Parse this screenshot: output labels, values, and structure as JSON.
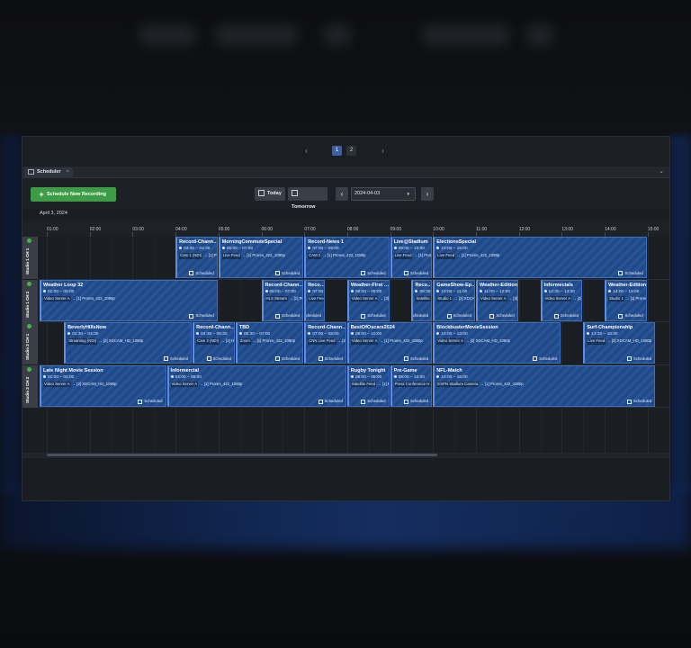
{
  "pager": {
    "prev": "‹",
    "next": "›",
    "pages": [
      "1",
      "2"
    ],
    "active_page": "1"
  },
  "tab": {
    "label": "Scheduler",
    "close": "×"
  },
  "toolbar": {
    "schedule_label": "Schedule New Recording",
    "today_label": "Today",
    "tomorrow_label": "Tomorrow",
    "date_value": "2024-04-03",
    "prev_arrow": "‹",
    "next_arrow": "›"
  },
  "date_label": "April 3, 2024",
  "timeline": {
    "hours": [
      "01:00",
      "02:00",
      "03:00",
      "04:00",
      "05:00",
      "06:00",
      "07:00",
      "08:00",
      "09:00",
      "10:00",
      "11:00",
      "12:00",
      "13:00",
      "14:00",
      "15:00"
    ]
  },
  "rows": [
    {
      "label": "Studio 1 CH 1",
      "status": "online"
    },
    {
      "label": "Studio 1 CH 2",
      "status": "online"
    },
    {
      "label": "Studio 2 CH 1",
      "status": "online"
    },
    {
      "label": "Studio 2 CH 2",
      "status": "online"
    }
  ],
  "events": [
    {
      "row": 0,
      "start": 4.0,
      "end": 5.0,
      "title": "Record-Chann…",
      "time": "03:30 – 04:30",
      "in": "Cam 1 (NDI)",
      "out": "[1] Prores_422_1080p",
      "status": "Scheduled"
    },
    {
      "row": 0,
      "start": 5.0,
      "end": 7.0,
      "title": "MorningCommuteSpecial",
      "time": "05:00 – 07:00",
      "in": "Live Feed",
      "out": "[1] Prores_422_1080p",
      "status": "Scheduled"
    },
    {
      "row": 0,
      "start": 7.0,
      "end": 9.0,
      "title": "Record-News 1",
      "time": "07:00 – 09:00",
      "in": "CAM 2",
      "out": "[1] Prores_422_1080p",
      "status": "Scheduled"
    },
    {
      "row": 0,
      "start": 9.0,
      "end": 10.0,
      "title": "Live@Stadium",
      "time": "09:00 – 10:00",
      "in": "Live Feed",
      "out": "[1] Prores_422_1080p",
      "status": "Scheduled"
    },
    {
      "row": 0,
      "start": 10.0,
      "end": 15.0,
      "title": "ElectionsSpecial",
      "time": "10:00 – 15:00",
      "in": "Live Feed",
      "out": "[1] Prores_422_1080p",
      "status": "Scheduled"
    },
    {
      "row": 1,
      "start": 0.8,
      "end": 5.0,
      "title": "Weather Loop 32",
      "time": "01:00 – 05:00",
      "in": "Video Server A",
      "out": "[1] Prores_422_1080p",
      "status": "Scheduled"
    },
    {
      "row": 1,
      "start": 6.0,
      "end": 7.0,
      "title": "Record-Chann…",
      "time": "06:00 – 07:00",
      "in": "HLS Stream",
      "out": "[1] Prores_422_1080p",
      "status": "Scheduled"
    },
    {
      "row": 1,
      "start": 7.0,
      "end": 7.5,
      "title": "Reco…",
      "time": "07:00",
      "in": "Live Feed",
      "out": "[1] Prores",
      "status": "Scheduled"
    },
    {
      "row": 1,
      "start": 8.0,
      "end": 9.0,
      "title": "Weather-First …",
      "time": "08:00 – 09:00",
      "in": "Video Server A",
      "out": "[3] AVCI_100M_1080p",
      "status": "Scheduled"
    },
    {
      "row": 1,
      "start": 9.5,
      "end": 10.0,
      "title": "Reco…",
      "time": "09:30",
      "in": "Satellite",
      "out": "[1] Prores",
      "status": "Scheduled"
    },
    {
      "row": 1,
      "start": 10.0,
      "end": 11.0,
      "title": "GameShow-Ep…",
      "time": "10:00 – 11:00",
      "in": "Studio 1",
      "out": "[2] XDCAM_HD_1080p",
      "status": "Scheduled"
    },
    {
      "row": 1,
      "start": 11.0,
      "end": 12.0,
      "title": "Weather-Edition2",
      "time": "11:00 – 12:00",
      "in": "Video Server A",
      "out": "[3] AVCI_100M_1080p",
      "status": "Scheduled"
    },
    {
      "row": 1,
      "start": 12.5,
      "end": 13.5,
      "title": "Informecials",
      "time": "12:30 – 13:30",
      "in": "Video Server A",
      "out": "[3] AVCI_100M_1080p",
      "status": "Scheduled"
    },
    {
      "row": 1,
      "start": 14.0,
      "end": 15.0,
      "title": "Weather-Edition3",
      "time": "14:00 – 15:00",
      "in": "Studio 1",
      "out": "[1] Prores_422_1080p",
      "status": "Scheduled"
    },
    {
      "row": 2,
      "start": 1.4,
      "end": 4.4,
      "title": "BeverlyHillsNow",
      "time": "01:30 – 04:30",
      "in": "Streaming (NDI)",
      "out": "[2] XDCAM_HD_1080p",
      "status": "Scheduled"
    },
    {
      "row": 2,
      "start": 4.4,
      "end": 5.4,
      "title": "Record-Chann…",
      "time": "04:30 – 05:30",
      "in": "Cam 2 (NDI)",
      "out": "[4] H.264_1080p_Mai",
      "status": "Scheduled"
    },
    {
      "row": 2,
      "start": 5.4,
      "end": 7.0,
      "title": "TBD",
      "time": "05:30 – 07:00",
      "in": "Zoom",
      "out": "[1] Prores_422_1080p",
      "status": "Scheduled"
    },
    {
      "row": 2,
      "start": 7.0,
      "end": 8.0,
      "title": "Record-Chann…",
      "time": "07:00 – 08:00",
      "in": "CNN Live Feed",
      "out": "[2] XDCAM_HD_1080p",
      "status": "Scheduled"
    },
    {
      "row": 2,
      "start": 8.0,
      "end": 10.0,
      "title": "BestOfOscars2024",
      "time": "08:00 – 10:00",
      "in": "Video Server A",
      "out": "[1] Prores_422_1080p",
      "status": "Scheduled"
    },
    {
      "row": 2,
      "start": 10.0,
      "end": 13.0,
      "title": "BlockbusterMovieSession",
      "time": "10:00 – 13:00",
      "in": "Video Server A",
      "out": "[2] XDCAM_HD_1080p",
      "status": "Scheduled"
    },
    {
      "row": 2,
      "start": 13.5,
      "end": 15.2,
      "title": "Surf-Championship",
      "time": "13:30 – 16:30",
      "in": "Live Feed",
      "out": "[2] XDCAM_HD_1080p",
      "status": "Scheduled"
    },
    {
      "row": 3,
      "start": 0.8,
      "end": 3.8,
      "title": "Late Night Movie Session",
      "time": "01:00 – 04:00",
      "in": "Video Server A",
      "out": "[2] XDCAM_HD_1080p",
      "status": "Scheduled"
    },
    {
      "row": 3,
      "start": 3.8,
      "end": 8.0,
      "title": "Informercial",
      "time": "04:00 – 08:00",
      "in": "Video Server A",
      "out": "[1] Prores_422_1080p",
      "status": "Scheduled"
    },
    {
      "row": 3,
      "start": 8.0,
      "end": 9.0,
      "title": "Rugby Tonight",
      "time": "08:00 – 09:00",
      "in": "Satellite Feed",
      "out": "[1] Prores_422_1080p",
      "status": "Scheduled"
    },
    {
      "row": 3,
      "start": 9.0,
      "end": 10.0,
      "title": "Pre-Game",
      "time": "09:00 – 10:00",
      "in": "Press Conference H…",
      "out": "[4] H.264_1080p_Mai",
      "status": "Scheduled"
    },
    {
      "row": 3,
      "start": 10.0,
      "end": 15.2,
      "title": "NFL-Match",
      "time": "10:00 – 16:00",
      "in": "ESPN Stadium Camera",
      "out": "[1] Prores_422_1080p",
      "status": "Scheduled"
    }
  ]
}
